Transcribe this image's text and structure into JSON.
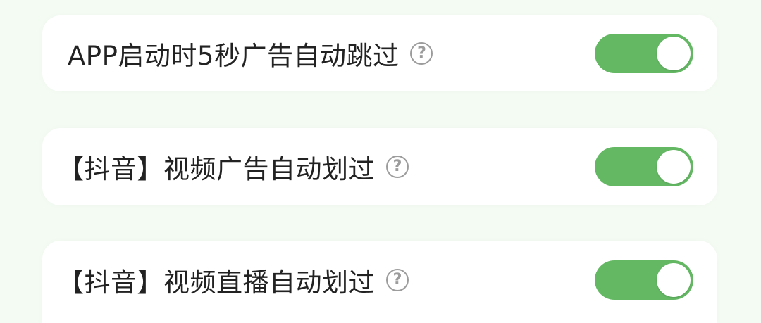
{
  "settings": {
    "items": [
      {
        "label": "APP启动时5秒广告自动跳过",
        "help_icon": "?",
        "enabled": true
      },
      {
        "label": "【抖音】视频广告自动划过",
        "help_icon": "?",
        "enabled": true
      },
      {
        "label": "【抖音】视频直播自动划过",
        "help_icon": "?",
        "enabled": true
      }
    ]
  },
  "colors": {
    "background": "#f4fbf3",
    "card": "#ffffff",
    "toggle_on": "#64b864",
    "text": "#222222",
    "help_icon": "#9c9c9c"
  }
}
